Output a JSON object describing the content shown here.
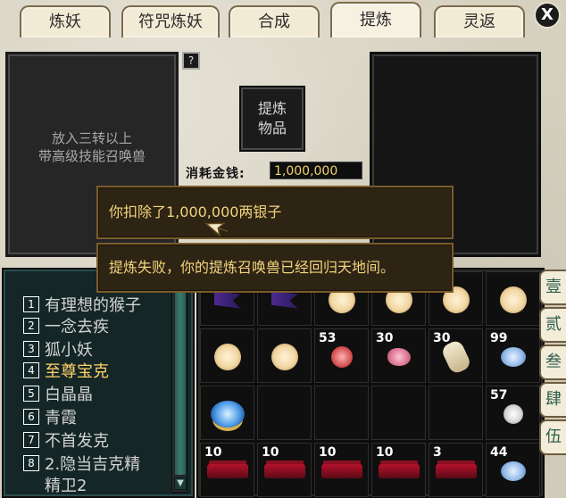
{
  "tabs": [
    {
      "label": "炼妖",
      "active": false
    },
    {
      "label": "符咒炼妖",
      "active": false
    },
    {
      "label": "合成",
      "active": false
    },
    {
      "label": "提炼",
      "active": true
    },
    {
      "label": "灵返",
      "active": false
    }
  ],
  "close": {
    "label": "X"
  },
  "left_panel": {
    "hint_line1": "放入三转以上",
    "hint_line2": "带高级技能召唤兽"
  },
  "help": {
    "label": "?"
  },
  "refine_button": {
    "line1": "提炼",
    "line2": "物品"
  },
  "cost": {
    "label": "消耗金钱:",
    "value": "1,000,000"
  },
  "messages": [
    {
      "text": "你扣除了1,000,000两银子"
    },
    {
      "text": "提炼失败，你的提炼召唤兽已经回归天地间。"
    }
  ],
  "pet_list": [
    {
      "num": "1",
      "name": "有理想的猴子",
      "highlight": false
    },
    {
      "num": "2",
      "name": "一念去疾",
      "highlight": false
    },
    {
      "num": "3",
      "name": "狐小妖",
      "highlight": false
    },
    {
      "num": "4",
      "name": "至尊宝克",
      "highlight": true
    },
    {
      "num": "5",
      "name": "白晶晶",
      "highlight": false
    },
    {
      "num": "6",
      "name": "青霞",
      "highlight": false
    },
    {
      "num": "7",
      "name": "不首发克",
      "highlight": false
    },
    {
      "num": "8",
      "name": "2.隐当吉克精",
      "highlight": false
    },
    {
      "num": "",
      "name": "精卫2",
      "highlight": false
    }
  ],
  "inventory": {
    "rows": [
      [
        {
          "icon": "purple-flag-icon",
          "qty": ""
        },
        {
          "icon": "purple-flag-icon",
          "qty": ""
        },
        {
          "icon": "lantern-icon",
          "qty": ""
        },
        {
          "icon": "lantern-icon",
          "qty": ""
        },
        {
          "icon": "lantern-icon",
          "qty": ""
        },
        {
          "icon": "lantern-icon",
          "qty": ""
        }
      ],
      [
        {
          "icon": "lantern-icon",
          "qty": ""
        },
        {
          "icon": "lantern-icon",
          "qty": ""
        },
        {
          "icon": "red-orb-icon",
          "qty": "53"
        },
        {
          "icon": "pink-flower-icon",
          "qty": "30"
        },
        {
          "icon": "bone-icon",
          "qty": "30"
        },
        {
          "icon": "blue-gem-icon",
          "qty": "99"
        }
      ],
      [
        {
          "icon": "crystal-ball-icon",
          "qty": ""
        },
        {
          "icon": "",
          "qty": ""
        },
        {
          "icon": "",
          "qty": ""
        },
        {
          "icon": "",
          "qty": ""
        },
        {
          "icon": "",
          "qty": ""
        },
        {
          "icon": "silver-orb-icon",
          "qty": "57"
        }
      ],
      [
        {
          "icon": "coffin-icon",
          "qty": "10"
        },
        {
          "icon": "coffin-icon",
          "qty": "10"
        },
        {
          "icon": "coffin-icon",
          "qty": "10"
        },
        {
          "icon": "coffin-icon",
          "qty": "10"
        },
        {
          "icon": "coffin-icon",
          "qty": "3"
        },
        {
          "icon": "blue-gem-icon",
          "qty": "44"
        }
      ]
    ]
  },
  "side_tabs": [
    "壹",
    "贰",
    "叁",
    "肆",
    "伍"
  ]
}
